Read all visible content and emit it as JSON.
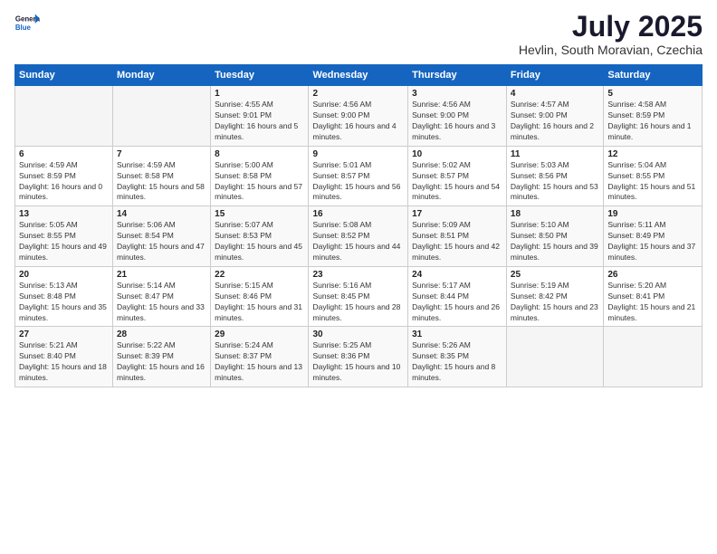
{
  "logo": {
    "line1": "General",
    "line2": "Blue"
  },
  "title": "July 2025",
  "location": "Hevlin, South Moravian, Czechia",
  "weekdays": [
    "Sunday",
    "Monday",
    "Tuesday",
    "Wednesday",
    "Thursday",
    "Friday",
    "Saturday"
  ],
  "weeks": [
    [
      {
        "day": "",
        "info": ""
      },
      {
        "day": "",
        "info": ""
      },
      {
        "day": "1",
        "info": "Sunrise: 4:55 AM\nSunset: 9:01 PM\nDaylight: 16 hours and 5 minutes."
      },
      {
        "day": "2",
        "info": "Sunrise: 4:56 AM\nSunset: 9:00 PM\nDaylight: 16 hours and 4 minutes."
      },
      {
        "day": "3",
        "info": "Sunrise: 4:56 AM\nSunset: 9:00 PM\nDaylight: 16 hours and 3 minutes."
      },
      {
        "day": "4",
        "info": "Sunrise: 4:57 AM\nSunset: 9:00 PM\nDaylight: 16 hours and 2 minutes."
      },
      {
        "day": "5",
        "info": "Sunrise: 4:58 AM\nSunset: 8:59 PM\nDaylight: 16 hours and 1 minute."
      }
    ],
    [
      {
        "day": "6",
        "info": "Sunrise: 4:59 AM\nSunset: 8:59 PM\nDaylight: 16 hours and 0 minutes."
      },
      {
        "day": "7",
        "info": "Sunrise: 4:59 AM\nSunset: 8:58 PM\nDaylight: 15 hours and 58 minutes."
      },
      {
        "day": "8",
        "info": "Sunrise: 5:00 AM\nSunset: 8:58 PM\nDaylight: 15 hours and 57 minutes."
      },
      {
        "day": "9",
        "info": "Sunrise: 5:01 AM\nSunset: 8:57 PM\nDaylight: 15 hours and 56 minutes."
      },
      {
        "day": "10",
        "info": "Sunrise: 5:02 AM\nSunset: 8:57 PM\nDaylight: 15 hours and 54 minutes."
      },
      {
        "day": "11",
        "info": "Sunrise: 5:03 AM\nSunset: 8:56 PM\nDaylight: 15 hours and 53 minutes."
      },
      {
        "day": "12",
        "info": "Sunrise: 5:04 AM\nSunset: 8:55 PM\nDaylight: 15 hours and 51 minutes."
      }
    ],
    [
      {
        "day": "13",
        "info": "Sunrise: 5:05 AM\nSunset: 8:55 PM\nDaylight: 15 hours and 49 minutes."
      },
      {
        "day": "14",
        "info": "Sunrise: 5:06 AM\nSunset: 8:54 PM\nDaylight: 15 hours and 47 minutes."
      },
      {
        "day": "15",
        "info": "Sunrise: 5:07 AM\nSunset: 8:53 PM\nDaylight: 15 hours and 45 minutes."
      },
      {
        "day": "16",
        "info": "Sunrise: 5:08 AM\nSunset: 8:52 PM\nDaylight: 15 hours and 44 minutes."
      },
      {
        "day": "17",
        "info": "Sunrise: 5:09 AM\nSunset: 8:51 PM\nDaylight: 15 hours and 42 minutes."
      },
      {
        "day": "18",
        "info": "Sunrise: 5:10 AM\nSunset: 8:50 PM\nDaylight: 15 hours and 39 minutes."
      },
      {
        "day": "19",
        "info": "Sunrise: 5:11 AM\nSunset: 8:49 PM\nDaylight: 15 hours and 37 minutes."
      }
    ],
    [
      {
        "day": "20",
        "info": "Sunrise: 5:13 AM\nSunset: 8:48 PM\nDaylight: 15 hours and 35 minutes."
      },
      {
        "day": "21",
        "info": "Sunrise: 5:14 AM\nSunset: 8:47 PM\nDaylight: 15 hours and 33 minutes."
      },
      {
        "day": "22",
        "info": "Sunrise: 5:15 AM\nSunset: 8:46 PM\nDaylight: 15 hours and 31 minutes."
      },
      {
        "day": "23",
        "info": "Sunrise: 5:16 AM\nSunset: 8:45 PM\nDaylight: 15 hours and 28 minutes."
      },
      {
        "day": "24",
        "info": "Sunrise: 5:17 AM\nSunset: 8:44 PM\nDaylight: 15 hours and 26 minutes."
      },
      {
        "day": "25",
        "info": "Sunrise: 5:19 AM\nSunset: 8:42 PM\nDaylight: 15 hours and 23 minutes."
      },
      {
        "day": "26",
        "info": "Sunrise: 5:20 AM\nSunset: 8:41 PM\nDaylight: 15 hours and 21 minutes."
      }
    ],
    [
      {
        "day": "27",
        "info": "Sunrise: 5:21 AM\nSunset: 8:40 PM\nDaylight: 15 hours and 18 minutes."
      },
      {
        "day": "28",
        "info": "Sunrise: 5:22 AM\nSunset: 8:39 PM\nDaylight: 15 hours and 16 minutes."
      },
      {
        "day": "29",
        "info": "Sunrise: 5:24 AM\nSunset: 8:37 PM\nDaylight: 15 hours and 13 minutes."
      },
      {
        "day": "30",
        "info": "Sunrise: 5:25 AM\nSunset: 8:36 PM\nDaylight: 15 hours and 10 minutes."
      },
      {
        "day": "31",
        "info": "Sunrise: 5:26 AM\nSunset: 8:35 PM\nDaylight: 15 hours and 8 minutes."
      },
      {
        "day": "",
        "info": ""
      },
      {
        "day": "",
        "info": ""
      }
    ]
  ]
}
